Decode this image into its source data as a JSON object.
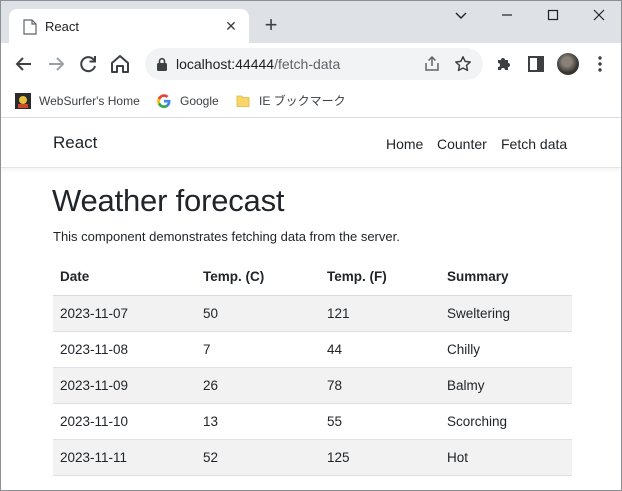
{
  "browser": {
    "tab": {
      "title": "React"
    },
    "address": {
      "host": "localhost:44444",
      "path": "/fetch-data"
    },
    "bookmarks": [
      {
        "label": "WebSurfer's Home"
      },
      {
        "label": "Google"
      },
      {
        "label": "IE ブックマーク"
      }
    ]
  },
  "app": {
    "brand": "React",
    "nav": [
      "Home",
      "Counter",
      "Fetch data"
    ],
    "title": "Weather forecast",
    "description": "This component demonstrates fetching data from the server.",
    "table": {
      "headers": [
        "Date",
        "Temp. (C)",
        "Temp. (F)",
        "Summary"
      ],
      "rows": [
        [
          "2023-11-07",
          "50",
          "121",
          "Sweltering"
        ],
        [
          "2023-11-08",
          "7",
          "44",
          "Chilly"
        ],
        [
          "2023-11-09",
          "26",
          "78",
          "Balmy"
        ],
        [
          "2023-11-10",
          "13",
          "55",
          "Scorching"
        ],
        [
          "2023-11-11",
          "52",
          "125",
          "Hot"
        ]
      ]
    }
  },
  "colors": {
    "chrome_frame": "#dee1e6",
    "omnibox": "#f1f3f4",
    "stripe": "#f2f2f2",
    "text": "#212529"
  }
}
